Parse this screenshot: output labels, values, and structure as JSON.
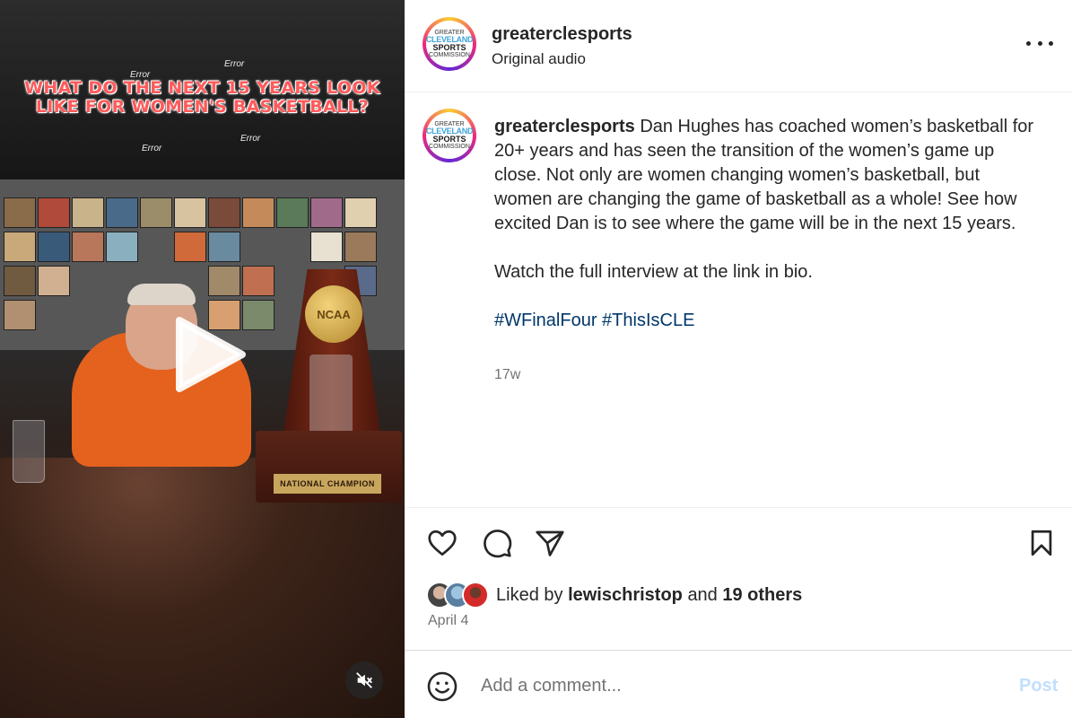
{
  "video": {
    "headline": "WHAT DO THE NEXT 15 YEARS LOOK LIKE FOR WOMEN'S BASKETBALL?",
    "overlay_errors": [
      "Error",
      "Error",
      "Error",
      "Error"
    ],
    "trophy_top": "NCAA",
    "trophy_plate": "NATIONAL CHAMPION"
  },
  "header": {
    "username": "greaterclesports",
    "audio": "Original audio",
    "avatar_lines": [
      "GREATER",
      "CLEVELAND",
      "SPORTS",
      "COMMISSION"
    ]
  },
  "caption": {
    "username": "greaterclesports",
    "text": "Dan Hughes has coached women’s basketball for 20+ years and has seen the transition of the women’s game up close. Not only are women changing women’s basketball, but women are changing the game of basketball as a whole! See how excited Dan is to see where the game will be in the next 15 years.",
    "line2": "Watch the full interview at the link in bio.",
    "hashtags": [
      "#WFinalFour",
      "#ThisIsCLE"
    ],
    "time_ago": "17w"
  },
  "likes": {
    "prefix": "Liked by",
    "user": "lewischristop",
    "middle": "and",
    "others": "19 others",
    "date": "April 4"
  },
  "comment": {
    "placeholder": "Add a comment...",
    "post_label": "Post"
  },
  "colors": {
    "link": "#00376b",
    "post_disabled": "#c0dffd",
    "secondary_text": "#737373"
  }
}
